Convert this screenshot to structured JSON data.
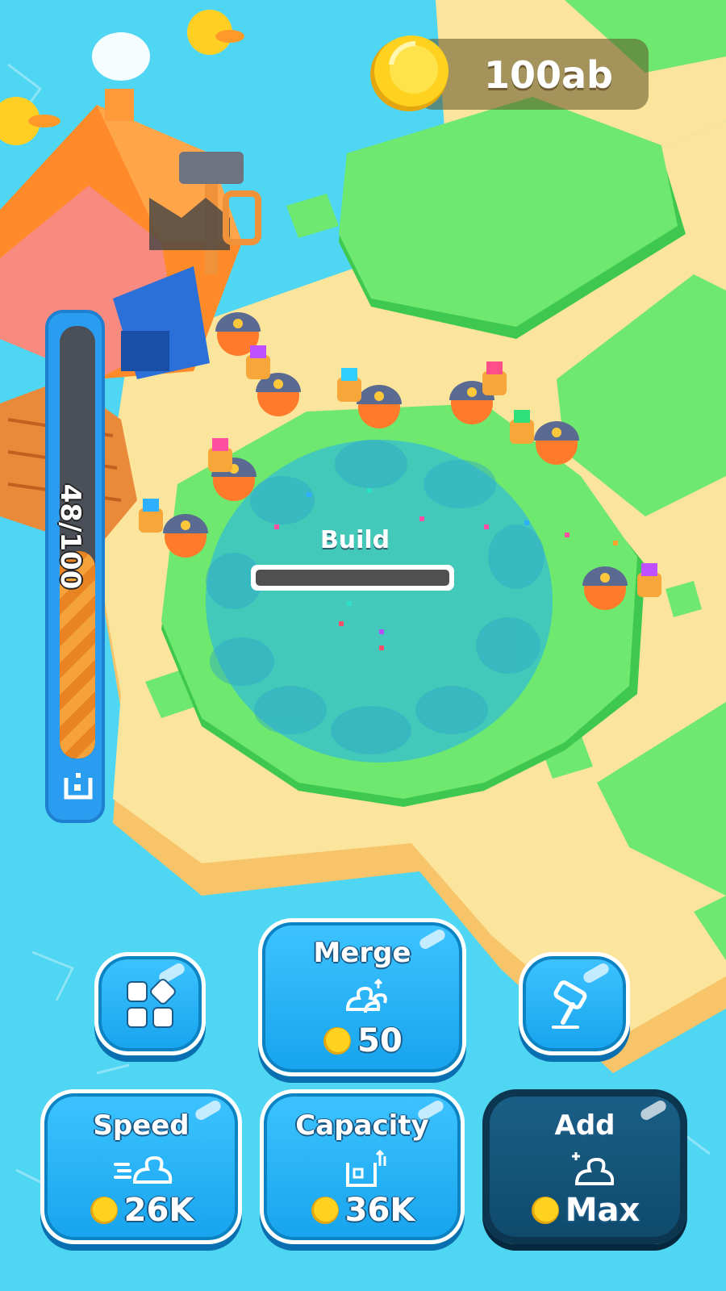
{
  "currency": {
    "amount": "100ab",
    "icon": "gold-coin-icon"
  },
  "capacity_meter": {
    "label": "48/100",
    "value": 48,
    "max": 100,
    "icon": "pile-icon"
  },
  "build": {
    "label": "Build",
    "progress": 0
  },
  "buttons": {
    "layout": {
      "icon": "grid-icon"
    },
    "merge": {
      "title": "Merge",
      "price": "50",
      "icon": "merge-ducks-icon"
    },
    "hammer": {
      "icon": "hammer-icon"
    },
    "speed": {
      "title": "Speed",
      "price": "26K",
      "icon": "fast-duck-icon"
    },
    "capacity": {
      "title": "Capacity",
      "price": "36K",
      "icon": "capacity-box-icon"
    },
    "add": {
      "title": "Add",
      "price": "Max",
      "icon": "add-duck-icon"
    }
  },
  "colors": {
    "water": "#4fd6f2",
    "sand": "#fbe49c",
    "grass": "#6ee86e",
    "button": "#1fb0f5",
    "button_disabled": "#114d70"
  }
}
